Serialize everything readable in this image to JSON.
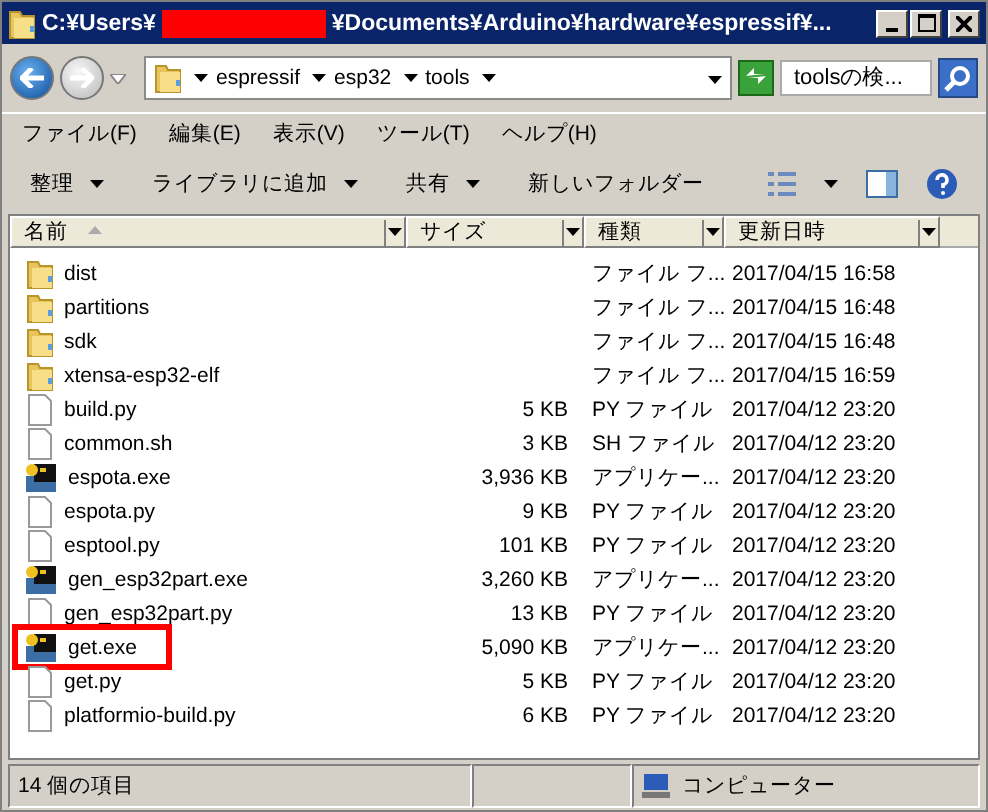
{
  "window": {
    "title_start": "C:¥Users¥",
    "title_redacted": true,
    "title_end": "¥Documents¥Arduino¥hardware¥espressif¥..."
  },
  "address": {
    "crumbs": [
      "espressif",
      "esp32",
      "tools"
    ],
    "search_placeholder": "toolsの検..."
  },
  "menu": [
    "ファイル(F)",
    "編集(E)",
    "表示(V)",
    "ツール(T)",
    "ヘルプ(H)"
  ],
  "commands": [
    {
      "label": "整理",
      "dropdown": true
    },
    {
      "label": "ライブラリに追加",
      "dropdown": true
    },
    {
      "label": "共有",
      "dropdown": true
    },
    {
      "label": "新しいフォルダー",
      "dropdown": false
    }
  ],
  "columns": [
    {
      "label": "名前",
      "sorted": true
    },
    {
      "label": "サイズ",
      "sorted": false
    },
    {
      "label": "種類",
      "sorted": false
    },
    {
      "label": "更新日時",
      "sorted": false
    }
  ],
  "rows": [
    {
      "kind": "folder",
      "name": "dist",
      "size": "",
      "type": "ファイル フ...",
      "date": "2017/04/15 16:58",
      "highlighted": false
    },
    {
      "kind": "folder",
      "name": "partitions",
      "size": "",
      "type": "ファイル フ...",
      "date": "2017/04/15 16:48",
      "highlighted": false
    },
    {
      "kind": "folder",
      "name": "sdk",
      "size": "",
      "type": "ファイル フ...",
      "date": "2017/04/15 16:48",
      "highlighted": false
    },
    {
      "kind": "folder",
      "name": "xtensa-esp32-elf",
      "size": "",
      "type": "ファイル フ...",
      "date": "2017/04/15 16:59",
      "highlighted": false
    },
    {
      "kind": "file",
      "name": "build.py",
      "size": "5 KB",
      "type": "PY ファイル",
      "date": "2017/04/12 23:20",
      "highlighted": false
    },
    {
      "kind": "file",
      "name": "common.sh",
      "size": "3 KB",
      "type": "SH ファイル",
      "date": "2017/04/12 23:20",
      "highlighted": false
    },
    {
      "kind": "exe",
      "name": "espota.exe",
      "size": "3,936 KB",
      "type": "アプリケー...",
      "date": "2017/04/12 23:20",
      "highlighted": false
    },
    {
      "kind": "file",
      "name": "espota.py",
      "size": "9 KB",
      "type": "PY ファイル",
      "date": "2017/04/12 23:20",
      "highlighted": false
    },
    {
      "kind": "file",
      "name": "esptool.py",
      "size": "101 KB",
      "type": "PY ファイル",
      "date": "2017/04/12 23:20",
      "highlighted": false
    },
    {
      "kind": "exe",
      "name": "gen_esp32part.exe",
      "size": "3,260 KB",
      "type": "アプリケー...",
      "date": "2017/04/12 23:20",
      "highlighted": false
    },
    {
      "kind": "file",
      "name": "gen_esp32part.py",
      "size": "13 KB",
      "type": "PY ファイル",
      "date": "2017/04/12 23:20",
      "highlighted": false
    },
    {
      "kind": "exe",
      "name": "get.exe",
      "size": "5,090 KB",
      "type": "アプリケー...",
      "date": "2017/04/12 23:20",
      "highlighted": true
    },
    {
      "kind": "file",
      "name": "get.py",
      "size": "5 KB",
      "type": "PY ファイル",
      "date": "2017/04/12 23:20",
      "highlighted": false
    },
    {
      "kind": "file",
      "name": "platformio-build.py",
      "size": "6 KB",
      "type": "PY ファイル",
      "date": "2017/04/12 23:20",
      "highlighted": false
    }
  ],
  "status": {
    "count": "14 個の項目",
    "zone": "コンピューター"
  }
}
